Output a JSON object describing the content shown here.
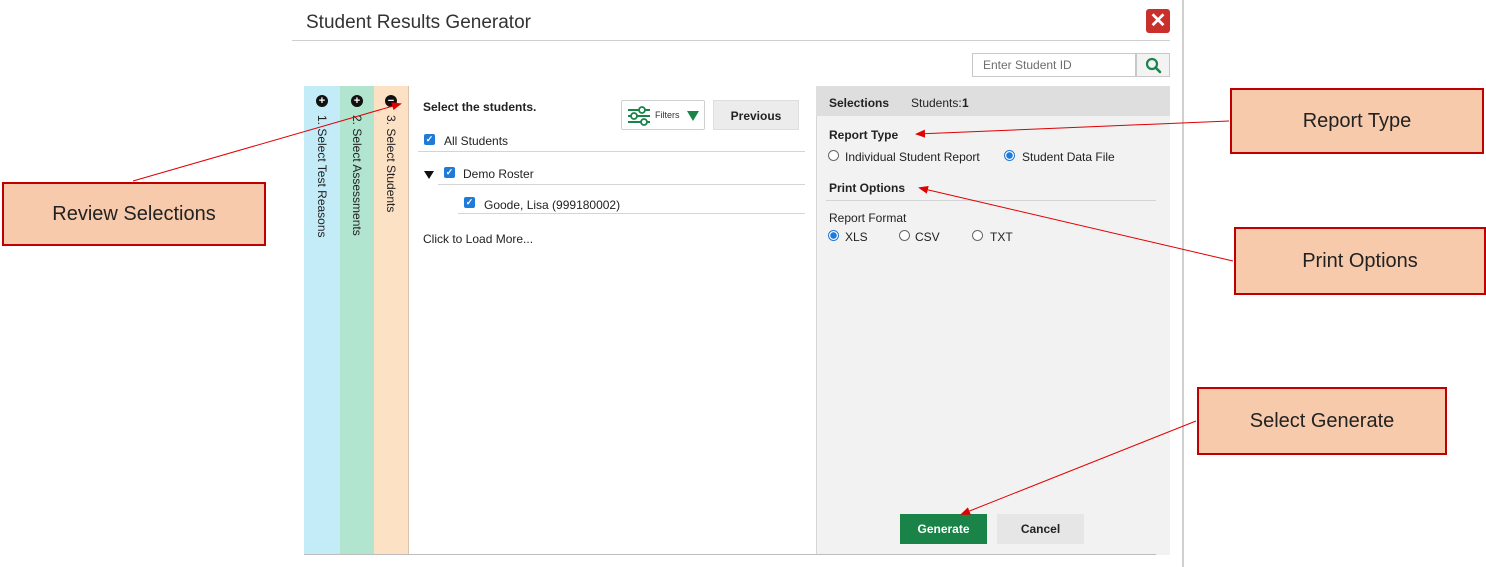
{
  "dialog": {
    "title": "Student Results Generator",
    "close_symbol": "✕",
    "search": {
      "placeholder": "Enter Student ID"
    }
  },
  "steps": [
    {
      "number": "1",
      "label": "1. Select Test Reasons",
      "state": "collapsed",
      "icon": "plus-circle-icon",
      "color": "#c4ecf8"
    },
    {
      "number": "2",
      "label": "2. Select Assessments",
      "state": "collapsed",
      "icon": "plus-circle-icon",
      "color": "#b2e5cf"
    },
    {
      "number": "3",
      "label": "3. Select Students",
      "state": "expanded",
      "icon": "minus-circle-icon",
      "color": "#fce1c5"
    }
  ],
  "students_panel": {
    "title": "Select the students.",
    "filters_label": "Filters",
    "previous_label": "Previous",
    "all_students_label": "All Students",
    "roster_label": "Demo Roster",
    "student_label": "Goode, Lisa (999180002)",
    "load_more_label": "Click to Load More..."
  },
  "selections_panel": {
    "header_title": "Selections",
    "students_label": "Students:",
    "students_count": "1",
    "report_type_heading": "Report Type",
    "report_types": [
      {
        "label": "Individual Student Report",
        "selected": false
      },
      {
        "label": "Student Data File",
        "selected": true
      }
    ],
    "print_options_heading": "Print Options",
    "report_format_label": "Report Format",
    "formats": [
      {
        "label": "XLS",
        "selected": true
      },
      {
        "label": "CSV",
        "selected": false
      },
      {
        "label": "TXT",
        "selected": false
      }
    ],
    "generate_label": "Generate",
    "cancel_label": "Cancel"
  },
  "annotations": {
    "review_selections": "Review Selections",
    "report_type": "Report Type",
    "print_options": "Print Options",
    "select_generate": "Select Generate"
  },
  "colors": {
    "generate_green": "#1a8448",
    "close_red": "#c9302c",
    "checkbox_blue": "#1f7ad8",
    "callout_fill": "#f7caac",
    "callout_border": "#c00000",
    "arrow_red": "#e00000"
  }
}
